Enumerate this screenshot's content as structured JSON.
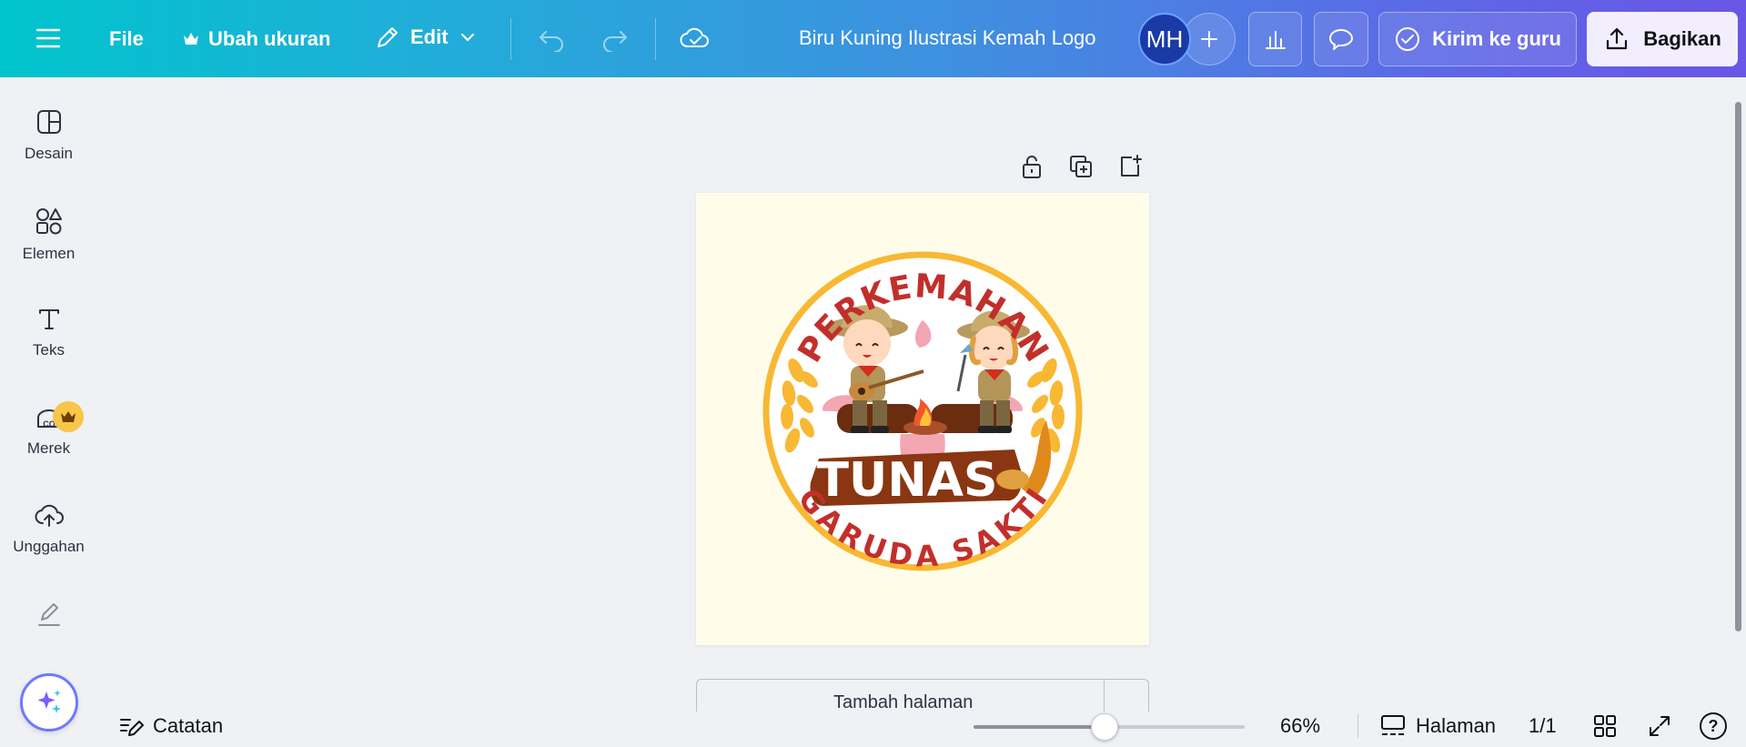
{
  "topbar": {
    "menu_icon": "hamburger-icon",
    "file_label": "File",
    "resize_label": "Ubah ukuran",
    "edit_label": "Edit",
    "document_title": "Biru Kuning Ilustrasi Kemah Logo",
    "avatar_initials": "MH",
    "submit_teacher_label": "Kirim ke guru",
    "share_label": "Bagikan"
  },
  "sidebar": {
    "items": [
      {
        "label": "Desain",
        "icon": "design-layout-icon"
      },
      {
        "label": "Elemen",
        "icon": "elements-shapes-icon"
      },
      {
        "label": "Teks",
        "icon": "text-icon"
      },
      {
        "label": "Merek",
        "icon": "brand-icon"
      },
      {
        "label": "Unggahan",
        "icon": "upload-cloud-icon"
      },
      {
        "label": "",
        "icon": "draw-icon"
      }
    ]
  },
  "canvas": {
    "background_color": "#fffdea",
    "logo": {
      "top_text": "PERKEMAHAN",
      "banner_text": "TUNAS",
      "bottom_text": "GARUDA SAKTI",
      "ring_color": "#f8b834",
      "text_color": "#c22f2b",
      "banner_color": "#8a3612"
    },
    "add_page_label": "Tambah halaman"
  },
  "bottombar": {
    "notes_label": "Catatan",
    "zoom_value": 66,
    "zoom_label": "66%",
    "pages_label": "Halaman",
    "page_count": "1/1",
    "help_label": "?"
  },
  "colors": {
    "topbar_start": "#00c4cc",
    "topbar_end": "#6a55e6",
    "share_bg": "#f3eefe"
  }
}
